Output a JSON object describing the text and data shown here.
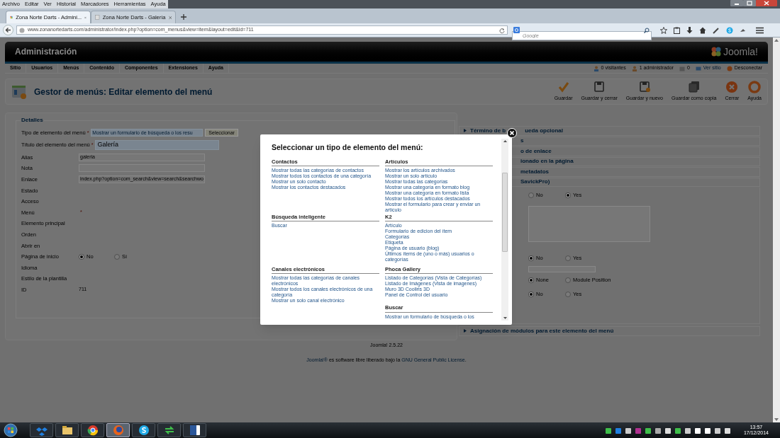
{
  "browser": {
    "menu": [
      "Archivo",
      "Editar",
      "Ver",
      "Historial",
      "Marcadores",
      "Herramientas",
      "Ayuda"
    ],
    "tabs": [
      {
        "title": "Zona Norte Darts - Admini...",
        "selected": true
      },
      {
        "title": "Zona Norte Darts - Galería",
        "selected": false
      }
    ],
    "url": "www.zonanortedarts.com/administrator/index.php?option=com_menus&view=item&layout=edit&id=711",
    "search": {
      "placeholder": "Google"
    }
  },
  "admin": {
    "title": "Administración",
    "logo": "Joomla!",
    "nav": [
      "Sitio",
      "Usuarios",
      "Menús",
      "Contenido",
      "Componentes",
      "Extensiones",
      "Ayuda"
    ],
    "status": [
      {
        "kind": "visitors",
        "text": "0 visitantes"
      },
      {
        "kind": "admins",
        "text": "1 administrador"
      },
      {
        "kind": "messages",
        "text": "0"
      },
      {
        "kind": "site",
        "text": "Ver sitio"
      },
      {
        "kind": "logout",
        "text": "Desconectar"
      }
    ]
  },
  "page_title": "Gestor de menús: Editar elemento del menú",
  "toolbar": [
    {
      "kind": "check",
      "label": "Guardar"
    },
    {
      "kind": "save",
      "label": "Guardar y cerrar"
    },
    {
      "kind": "save-new",
      "label": "Guardar y nuevo"
    },
    {
      "kind": "copy",
      "label": "Guardar como copia"
    },
    {
      "kind": "close",
      "label": "Cerrar"
    },
    {
      "kind": "help",
      "label": "Ayuda"
    }
  ],
  "details": {
    "legend": "Detalles",
    "fields": [
      {
        "label": "Tipo de elemento del menú",
        "mark": "*",
        "kind": "select",
        "value": "Mostrar un formulario de búsqueda o los resu",
        "button": "Seleccionar"
      },
      {
        "label": "Título del elemento del menú",
        "mark": "*",
        "kind": "title",
        "value": "Galería"
      },
      {
        "label": "Alias",
        "kind": "input",
        "value": "galeria"
      },
      {
        "label": "Nota",
        "kind": "input"
      },
      {
        "label": "Enlace",
        "kind": "input",
        "value": "index.php?option=com_search&view=search&searchwo"
      },
      {
        "label": "Estado",
        "kind": "label"
      },
      {
        "label": "Acceso",
        "kind": "label"
      },
      {
        "label": "Menú",
        "mark": "*",
        "kind": "label"
      },
      {
        "label": "Elemento principal",
        "kind": "label"
      },
      {
        "label": "Orden",
        "kind": "label"
      },
      {
        "label": "Abrir en",
        "kind": "label"
      },
      {
        "label": "Página de inicio",
        "kind": "radio",
        "options": [
          {
            "label": "No",
            "selected": true
          },
          {
            "label": "Sí",
            "selected": false
          }
        ]
      },
      {
        "label": "Idioma",
        "kind": "label"
      },
      {
        "label": "Estilo de la plantilla",
        "kind": "label"
      },
      {
        "label": "ID",
        "kind": "text",
        "value": "711"
      }
    ]
  },
  "right_panel": {
    "first_section": [
      "Término de b",
      "ueda opcional"
    ],
    "cut_sections": [
      "s",
      "o de enlace",
      "ionado en la página",
      "metadatos",
      "SavickPro)"
    ],
    "form": [
      {
        "kind": "radio",
        "options": [
          {
            "label": "No",
            "selected": false
          },
          {
            "label": "Yes",
            "selected": true
          }
        ]
      },
      {
        "kind": "textarea"
      },
      {
        "kind": "radio",
        "options": [
          {
            "label": "No",
            "selected": true
          },
          {
            "label": "Yes",
            "selected": false
          }
        ]
      },
      {
        "kind": "input"
      },
      {
        "kind": "radio",
        "options": [
          {
            "label": "None",
            "selected": true
          },
          {
            "label": "Module Position",
            "selected": false
          }
        ]
      },
      {
        "kind": "radio",
        "options": [
          {
            "label": "No",
            "selected": true
          },
          {
            "label": "Yes",
            "selected": false
          }
        ]
      }
    ],
    "last_section": "Asignación de módulos para este elemento del menú"
  },
  "modal": {
    "title": "Seleccionar un tipo de elemento del menú:",
    "rows": [
      {
        "left": {
          "heading": "Contactos",
          "items": [
            "Mostrar todas las categorías de contactos",
            "Mostrar todos los contactos de una categoría",
            "Mostrar un solo contacto",
            "Mostrar los contactos destacados"
          ]
        },
        "right": {
          "heading": "Artículos",
          "items": [
            "Mostrar los artículos archivados",
            "Mostrar un solo artículo",
            "Mostrar todas las categorías",
            "Mostrar una categoría en formato blog",
            "Mostrar una categoría en formato lista",
            "Mostrar todos los artículos destacados",
            "Mostrar el formulario para crear y enviar un artículo"
          ]
        }
      },
      {
        "left": {
          "heading": "Búsqueda inteligente",
          "items": [
            "Buscar"
          ]
        },
        "right": {
          "heading": "K2",
          "items": [
            "Artículo",
            "Formulario de edicion del ítem",
            "Categorías",
            "Etiqueta",
            "Página de usuario (blog)",
            "Últimos ítems de (uno o más) usuarios o categorías"
          ]
        }
      },
      {
        "left": {
          "heading": "Canales electrónicos",
          "items": [
            "Mostrar todas las categorías de canales electrónicos",
            "Mostrar todos los canales electrónicos de una categoría",
            "Mostrar un solo canal electrónico"
          ]
        },
        "right": {
          "heading": "Phoca Gallery",
          "items": [
            "Listado de Categorías (Vista de Categorías)",
            "Listado de Imágenes (Vista de imagenes)",
            "Muro 3D Cooliris 3D",
            "Panel de Control del usuario"
          ]
        }
      },
      {
        "right": {
          "heading": "Buscar",
          "items": [
            "Mostrar un formulario de búsqueda o los"
          ]
        }
      }
    ]
  },
  "footer": {
    "version": "Joomla! 2.5.22",
    "license": [
      {
        "text": "Joomla!®",
        "link": true
      },
      {
        "text": " es software libre liberado bajo la "
      },
      {
        "text": "GNU General Public License",
        "link": true
      },
      {
        "text": "."
      }
    ]
  },
  "taskbar": {
    "apps": [
      {
        "kind": "dropbox",
        "selected": false
      },
      {
        "kind": "folder",
        "selected": false
      },
      {
        "kind": "chrome",
        "selected": false
      },
      {
        "kind": "firefox",
        "selected": true
      },
      {
        "kind": "skype",
        "selected": false
      },
      {
        "kind": "sync",
        "selected": false
      },
      {
        "kind": "word",
        "selected": false
      }
    ],
    "time": "13:57",
    "date": "17/12/2014"
  }
}
